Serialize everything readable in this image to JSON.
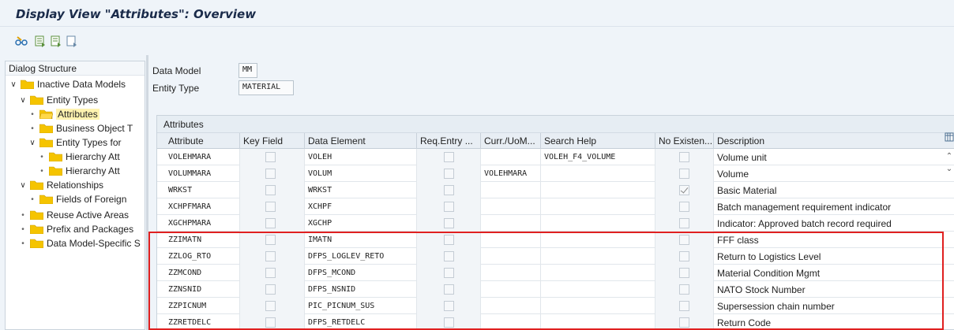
{
  "window": {
    "title": "Display View \"Attributes\": Overview"
  },
  "toolbar": {
    "buttons": [
      {
        "icon": "glasses-display-icon"
      },
      {
        "icon": "select-all-icon"
      },
      {
        "icon": "select-block-icon"
      },
      {
        "icon": "deselect-all-icon"
      }
    ]
  },
  "dialog_structure": {
    "header": "Dialog Structure",
    "items": [
      {
        "label": "Inactive Data Models",
        "level": 0,
        "expanded": true
      },
      {
        "label": "Entity Types",
        "level": 1,
        "expanded": true
      },
      {
        "label": "Attributes",
        "level": 2,
        "selected": true
      },
      {
        "label": "Business Object T",
        "level": 2
      },
      {
        "label": "Entity Types for",
        "level": 2,
        "expanded": true
      },
      {
        "label": "Hierarchy Att",
        "level": 3
      },
      {
        "label": "Hierarchy Att",
        "level": 3
      },
      {
        "label": "Relationships",
        "level": 1,
        "expanded": true
      },
      {
        "label": "Fields of Foreign",
        "level": 2
      },
      {
        "label": "Reuse Active Areas",
        "level": 1
      },
      {
        "label": "Prefix and Packages",
        "level": 1
      },
      {
        "label": "Data Model-Specific S",
        "level": 1
      }
    ]
  },
  "fields": {
    "data_model_label": "Data Model",
    "data_model_value": "MM",
    "entity_type_label": "Entity Type",
    "entity_type_value": "MATERIAL"
  },
  "grid": {
    "title": "Attributes",
    "columns": [
      "Attribute",
      "Key Field",
      "Data Element",
      "Req.Entry ...",
      "Curr./UoM...",
      "Search Help",
      "No Existen...",
      "Description"
    ],
    "rows": [
      {
        "attribute": "VOLEHMARA",
        "key": false,
        "element": "VOLEH",
        "req": false,
        "curr": "",
        "search": "VOLEH_F4_VOLUME",
        "noexist": false,
        "desc": "Volume unit"
      },
      {
        "attribute": "VOLUMMARA",
        "key": false,
        "element": "VOLUM",
        "req": false,
        "curr": "VOLEHMARA",
        "search": "",
        "noexist": false,
        "desc": "Volume"
      },
      {
        "attribute": "WRKST",
        "key": false,
        "element": "WRKST",
        "req": false,
        "curr": "",
        "search": "",
        "noexist": true,
        "desc": "Basic Material"
      },
      {
        "attribute": "XCHPFMARA",
        "key": false,
        "element": "XCHPF",
        "req": false,
        "curr": "",
        "search": "",
        "noexist": false,
        "desc": "Batch management requirement indicator"
      },
      {
        "attribute": "XGCHPMARA",
        "key": false,
        "element": "XGCHP",
        "req": false,
        "curr": "",
        "search": "",
        "noexist": false,
        "desc": "Indicator: Approved batch record required"
      },
      {
        "attribute": "ZZIMATN",
        "key": false,
        "element": "IMATN",
        "req": false,
        "curr": "",
        "search": "",
        "noexist": false,
        "desc": "FFF class"
      },
      {
        "attribute": "ZZLOG_RTO",
        "key": false,
        "element": "DFPS_LOGLEV_RETO",
        "req": false,
        "curr": "",
        "search": "",
        "noexist": false,
        "desc": "Return to Logistics Level"
      },
      {
        "attribute": "ZZMCOND",
        "key": false,
        "element": "DFPS_MCOND",
        "req": false,
        "curr": "",
        "search": "",
        "noexist": false,
        "desc": "Material Condition Mgmt"
      },
      {
        "attribute": "ZZNSNID",
        "key": false,
        "element": "DFPS_NSNID",
        "req": false,
        "curr": "",
        "search": "",
        "noexist": false,
        "desc": "NATO Stock Number"
      },
      {
        "attribute": "ZZPICNUM",
        "key": false,
        "element": "PIC_PICNUM_SUS",
        "req": false,
        "curr": "",
        "search": "",
        "noexist": false,
        "desc": "Supersession chain number"
      },
      {
        "attribute": "ZZRETDELC",
        "key": false,
        "element": "DFPS_RETDELC",
        "req": false,
        "curr": "",
        "search": "",
        "noexist": false,
        "desc": "Return Code"
      }
    ]
  },
  "colors": {
    "highlight": "#e02020",
    "folder": "#f5c400",
    "title": "#1a2b4a"
  }
}
